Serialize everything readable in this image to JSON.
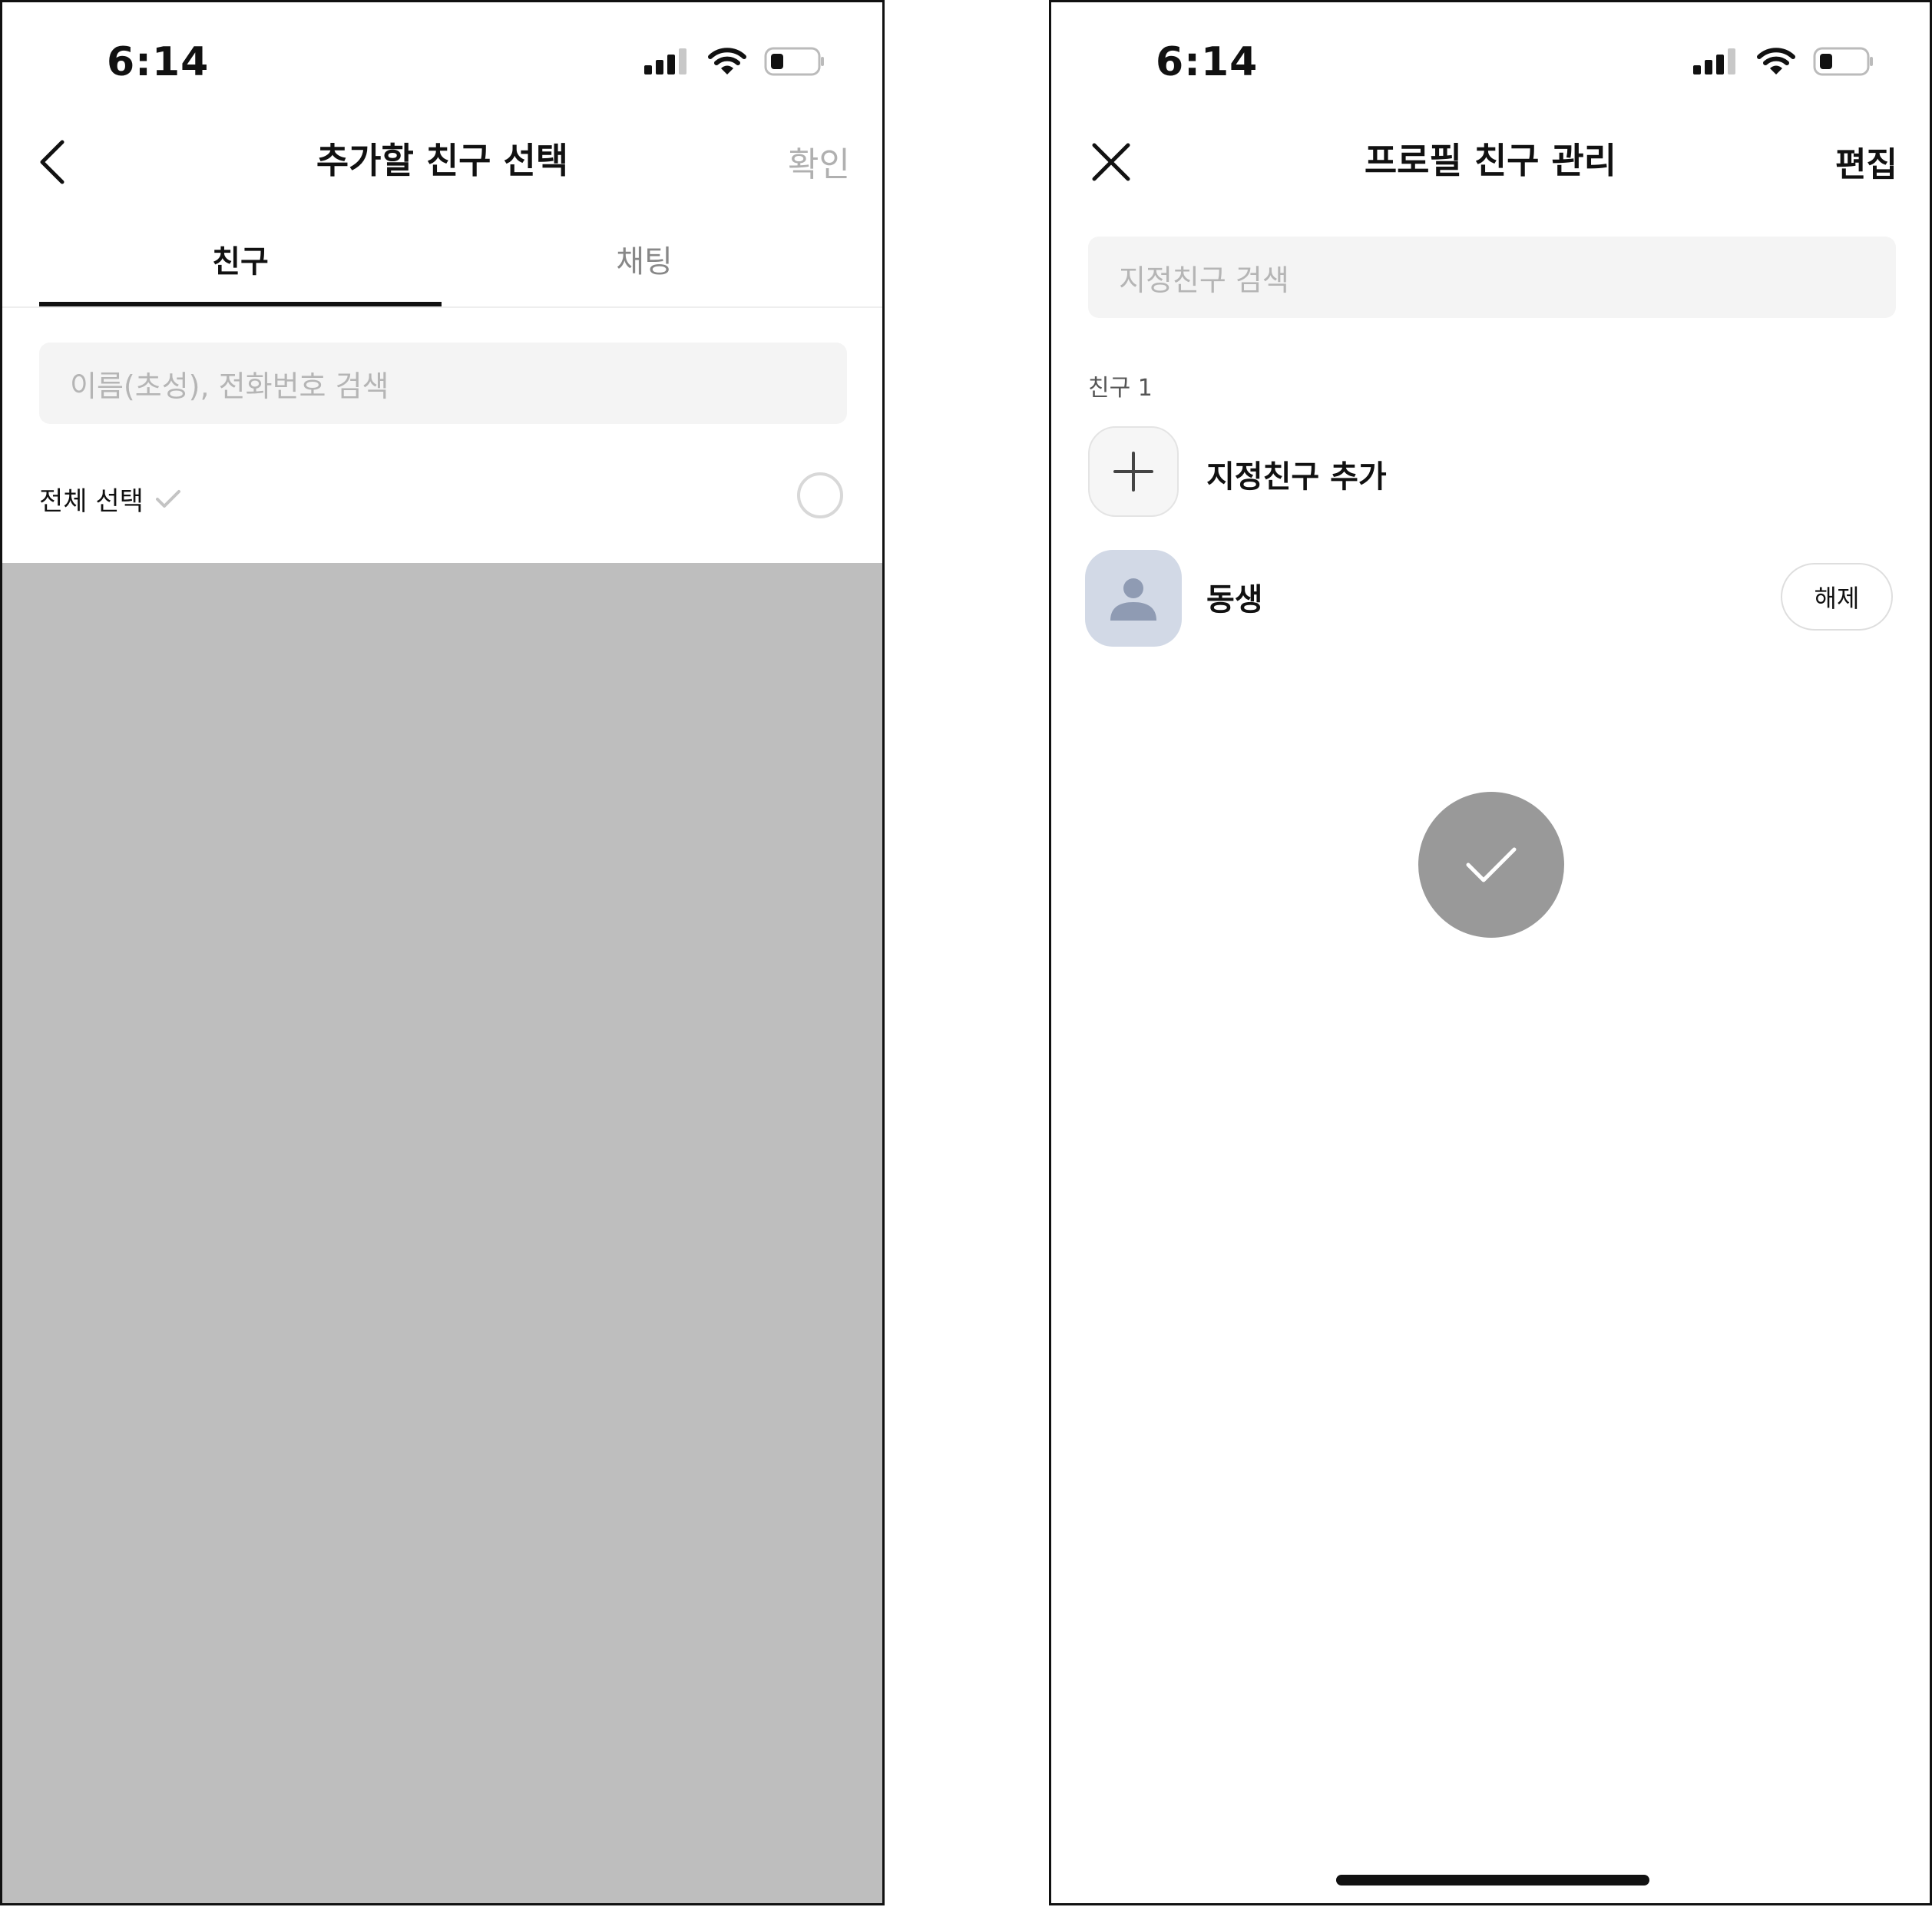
{
  "left_screen": {
    "status": {
      "time": "6:14"
    },
    "nav": {
      "title": "추가할 친구 선택",
      "confirm_label": "확인"
    },
    "tabs": [
      {
        "label": "친구"
      },
      {
        "label": "채팅"
      }
    ],
    "search": {
      "placeholder": "이름(초성), 전화번호 검색"
    },
    "select_all": {
      "label": "전체 선택"
    }
  },
  "right_screen": {
    "status": {
      "time": "6:14"
    },
    "nav": {
      "title": "프로필 친구 관리",
      "edit_label": "편집"
    },
    "search": {
      "placeholder": "지정친구 검색"
    },
    "section": {
      "label": "친구 1"
    },
    "add_friend": {
      "label": "지정친구 추가"
    },
    "friends": [
      {
        "name": "동생",
        "action_label": "해제"
      }
    ]
  },
  "colors": {
    "overlay": "#bebebe",
    "fab": "#999999",
    "avatar_bg": "#d2d9e6",
    "avatar_icon": "#8f9bb3",
    "muted_text": "#b0b0b0"
  }
}
